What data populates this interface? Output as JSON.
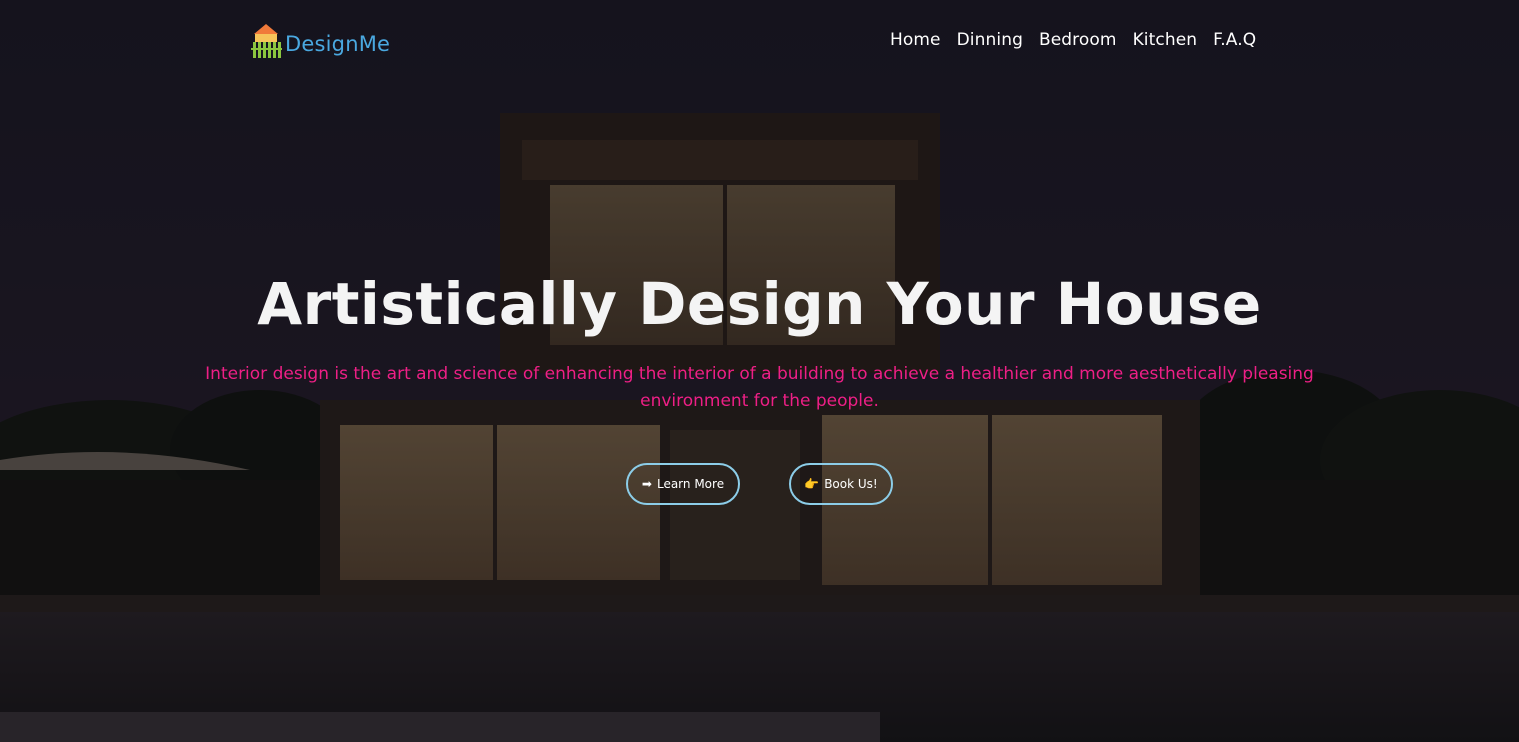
{
  "brand": {
    "name": "DesignMe",
    "logo_icon": "house-fence-icon",
    "roof_color": "#f07a3a",
    "fence_color": "#8cc63f",
    "text_color": "#4aa8e0"
  },
  "nav": {
    "items": [
      {
        "label": "Home"
      },
      {
        "label": "Dinning"
      },
      {
        "label": "Bedroom"
      },
      {
        "label": "Kitchen"
      },
      {
        "label": "F.A.Q"
      }
    ]
  },
  "hero": {
    "title": "Artistically Design Your House",
    "subtitle": "Interior design is the art and science of enhancing the interior of a building to achieve a healthier and more aesthetically pleasing environment for the people.",
    "subtitle_color": "#ee1f86",
    "buttons": [
      {
        "label": "Learn More",
        "icon": "arrow-right-icon",
        "glyph": "➡"
      },
      {
        "label": "Book Us!",
        "icon": "pointing-hand-icon",
        "glyph": "👉"
      }
    ],
    "button_border_color": "#8ccde8",
    "background": "modern-house-night-photo"
  }
}
